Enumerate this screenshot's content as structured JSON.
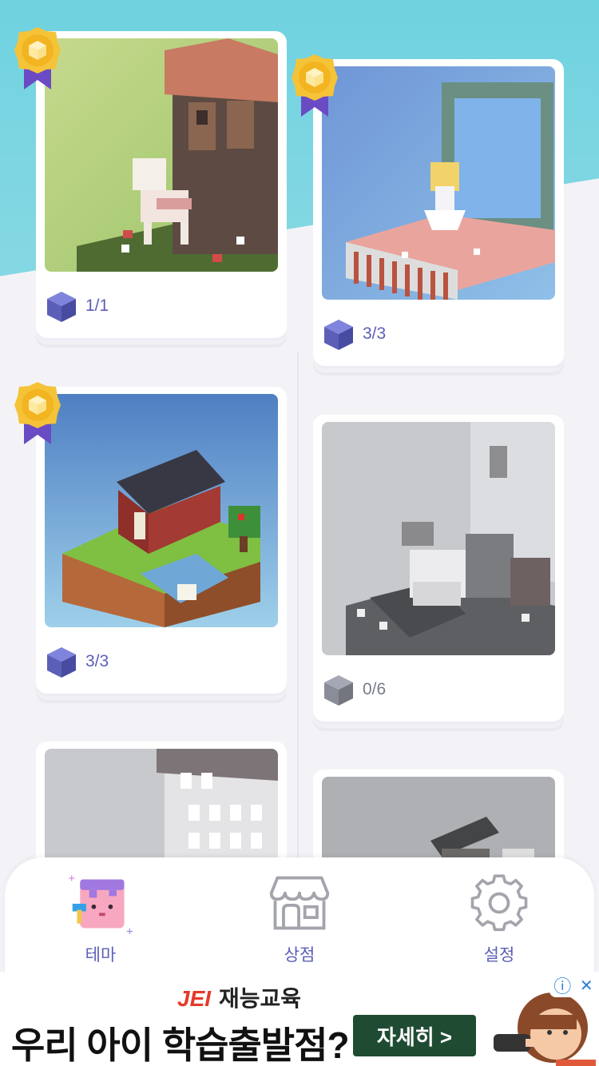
{
  "themes": [
    {
      "id": "llama",
      "count": "1/1",
      "completed": true
    },
    {
      "id": "music-box",
      "count": "3/3",
      "completed": true
    },
    {
      "id": "house",
      "count": "3/3",
      "completed": true
    },
    {
      "id": "grey-scene",
      "count": "0/6",
      "completed": false
    },
    {
      "id": "building",
      "count": "",
      "completed": false
    },
    {
      "id": "cabin",
      "count": "",
      "completed": false
    }
  ],
  "nav": {
    "theme_label": "테마",
    "shop_label": "상점",
    "settings_label": "설정"
  },
  "ad": {
    "brand_logo": "JEI",
    "brand_name": "재능교육",
    "headline": "우리 아이 학습출발점?",
    "cta": "자세히 >",
    "info_icon": "ⓘ",
    "close_icon": "✕"
  },
  "colors": {
    "accent": "#5b5fb8",
    "sky": "#7ed6e2",
    "badge_gold": "#f5c338",
    "ribbon": "#6a4bc4"
  }
}
